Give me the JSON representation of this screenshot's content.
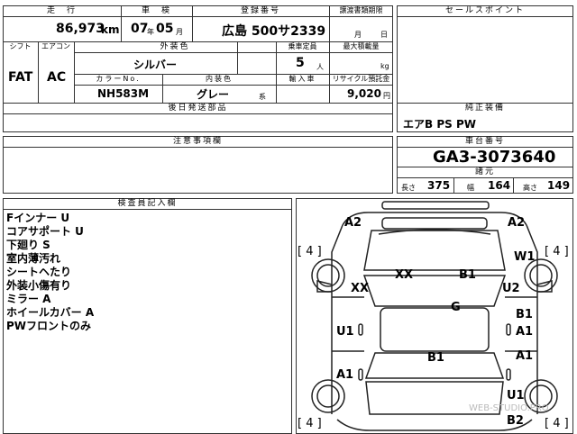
{
  "headers": {
    "mileage": "走　行",
    "inspection": "車　検",
    "registration": "登録番号",
    "transfer_deadline": "譲渡書類期限",
    "sales_point": "セールスポイント",
    "shift": "シフト",
    "aircon": "エアコン",
    "ext_color": "外装色",
    "capacity": "乗車定員",
    "max_load": "最大積載量",
    "color_no": "カラーNo.",
    "int_color": "内装色",
    "import": "輸入車",
    "recycle": "リサイクル預託金",
    "later_parts": "後日発送部品",
    "std_equipment": "純正装備",
    "notes": "注意事項欄",
    "chassis_no": "車台番号",
    "dimensions": "諸元",
    "inspector_notes": "検査員記入欄"
  },
  "vehicle": {
    "mileage": "86,973",
    "mileage_unit": "km",
    "inspection_year": "07",
    "inspection_month": "05",
    "inspection_unit": "月",
    "plate": "広島 500サ2339",
    "deadline_month_unit": "月",
    "deadline_day_unit": "日",
    "shift": "FAT",
    "aircon": "AC",
    "ext_color": "シルバー",
    "capacity": "5",
    "capacity_unit": "人",
    "load_unit": "kg",
    "color_no": "NH583M",
    "int_color": "グレー",
    "int_suffix": "系",
    "recycle": "9,020",
    "recycle_unit": "円",
    "equipment": "エアB PS PW",
    "chassis": "GA3-3073640",
    "length_label": "長さ",
    "length": "375",
    "width_label": "幅",
    "width": "164",
    "height_label": "高さ",
    "height": "149"
  },
  "inspector_lines": [
    "Fインナー U",
    "コアサポート U",
    "下廻り S",
    "室内薄汚れ",
    "シートヘたり",
    "外装小傷有り",
    "ミラー A",
    "ホイールカバー A",
    "PWフロントのみ"
  ],
  "diagram": {
    "tl": "A2",
    "tr": "A2",
    "wheel_fl": "[ 4 ]",
    "wheel_fr": "[ 4 ]",
    "wheel_rl": "[ 4 ]",
    "wheel_rr": "[ 4 ]",
    "hood_left": "XX",
    "hood_right": "B1",
    "fender_left": "XX",
    "fender_right_top": "W1",
    "fender_right": "U2",
    "roof": "G",
    "door_left": "U1",
    "door_right_top": "B1",
    "door_right": "A1",
    "trunk": "B1",
    "quarter_left": "A1",
    "quarter_right": "A1",
    "rear_right_1": "U1",
    "rear_right_2": "B2"
  },
  "watermark": "WEB-STUDIO.PRO"
}
